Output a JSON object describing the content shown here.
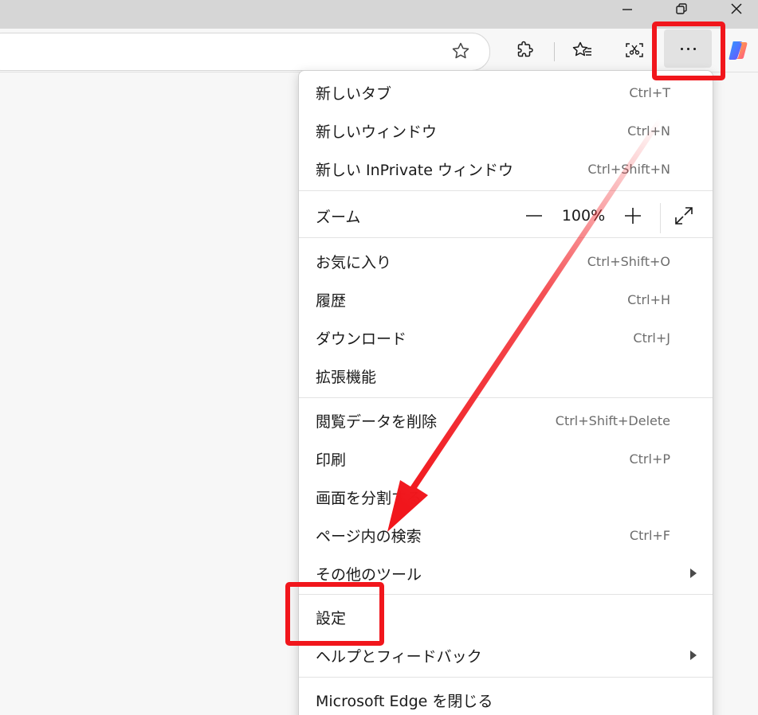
{
  "menu": {
    "items": [
      {
        "label": "新しいタブ",
        "shortcut": "Ctrl+T"
      },
      {
        "label": "新しいウィンドウ",
        "shortcut": "Ctrl+N"
      },
      {
        "label": "新しい InPrivate ウィンドウ",
        "shortcut": "Ctrl+Shift+N"
      },
      {
        "label": "お気に入り",
        "shortcut": "Ctrl+Shift+O"
      },
      {
        "label": "履歴",
        "shortcut": "Ctrl+H"
      },
      {
        "label": "ダウンロード",
        "shortcut": "Ctrl+J"
      },
      {
        "label": "拡張機能",
        "shortcut": ""
      },
      {
        "label": "閲覧データを削除",
        "shortcut": "Ctrl+Shift+Delete"
      },
      {
        "label": "印刷",
        "shortcut": "Ctrl+P"
      },
      {
        "label": "画面を分割する",
        "shortcut": ""
      },
      {
        "label": "ページ内の検索",
        "shortcut": "Ctrl+F"
      },
      {
        "label": "その他のツール",
        "shortcut": ""
      },
      {
        "label": "設定",
        "shortcut": ""
      },
      {
        "label": "ヘルプとフィードバック",
        "shortcut": ""
      },
      {
        "label": "Microsoft Edge を閉じる",
        "shortcut": ""
      }
    ],
    "zoom": {
      "label": "ズーム",
      "value": "100%"
    }
  },
  "icons": {
    "minimize": "minimize-icon",
    "restore": "restore-icon",
    "close": "close-icon",
    "favorite_star": "star-icon",
    "extensions": "puzzle-icon",
    "favorites": "favorites-icon",
    "screenshot": "screenshot-icon",
    "more": "more-icon",
    "copilot": "copilot-icon",
    "zoom_out": "minus-icon",
    "zoom_in": "plus-icon",
    "fullscreen": "fullscreen-icon",
    "submenu": "chevron-right-icon"
  },
  "colors": {
    "highlight": "#f1161c",
    "arrow": "#f1161c"
  }
}
